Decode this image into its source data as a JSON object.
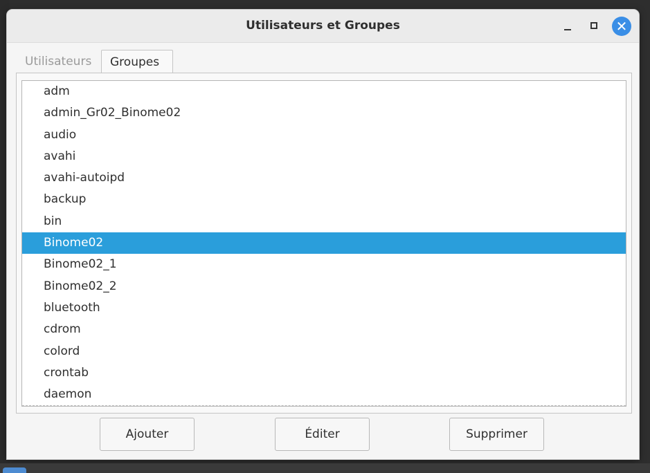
{
  "window": {
    "title": "Utilisateurs et Groupes",
    "controls": {
      "minimize": "minimize-icon",
      "maximize": "maximize-icon",
      "close": "close-icon",
      "close_glyph": "✕"
    }
  },
  "tabs": [
    {
      "label": "Utilisateurs",
      "active": false
    },
    {
      "label": "Groupes",
      "active": true
    }
  ],
  "groups": [
    {
      "name": "adm",
      "selected": false
    },
    {
      "name": "admin_Gr02_Binome02",
      "selected": false
    },
    {
      "name": "audio",
      "selected": false
    },
    {
      "name": "avahi",
      "selected": false
    },
    {
      "name": "avahi-autoipd",
      "selected": false
    },
    {
      "name": "backup",
      "selected": false
    },
    {
      "name": "bin",
      "selected": false
    },
    {
      "name": "Binome02",
      "selected": true
    },
    {
      "name": "Binome02_1",
      "selected": false
    },
    {
      "name": "Binome02_2",
      "selected": false
    },
    {
      "name": "bluetooth",
      "selected": false
    },
    {
      "name": "cdrom",
      "selected": false
    },
    {
      "name": "colord",
      "selected": false
    },
    {
      "name": "crontab",
      "selected": false
    },
    {
      "name": "daemon",
      "selected": false
    }
  ],
  "actions": {
    "add_label": "Ajouter",
    "edit_label": "Éditer",
    "delete_label": "Supprimer"
  },
  "colors": {
    "selection": "#2a9edb",
    "close_button": "#3a8ee6"
  }
}
